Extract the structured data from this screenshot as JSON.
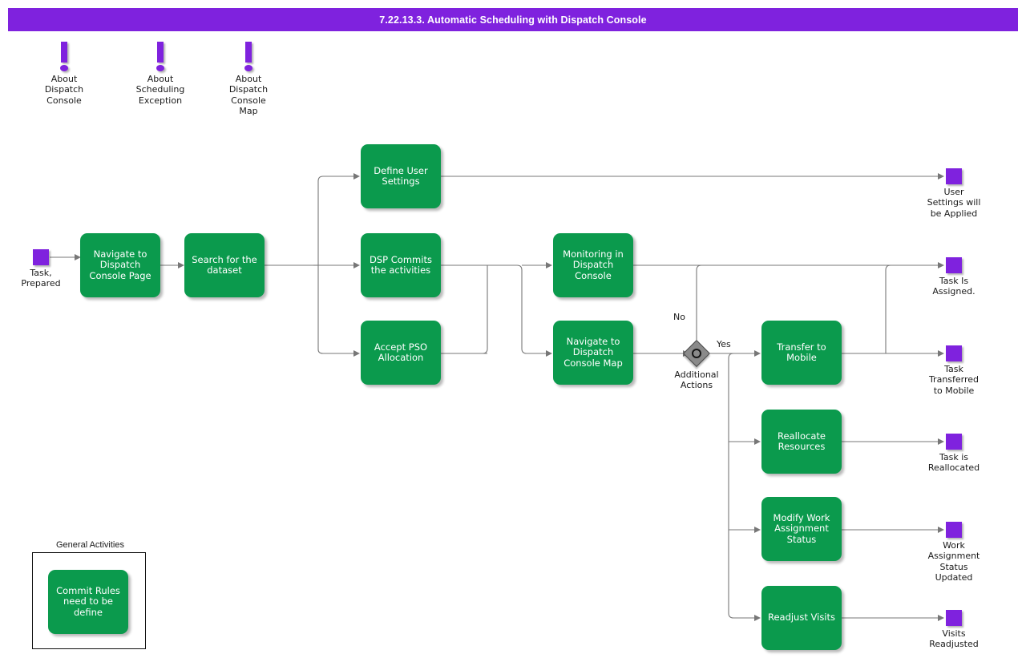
{
  "header": {
    "title": "7.22.13.3. Automatic Scheduling with Dispatch Console",
    "bar_color": "#7F22DE"
  },
  "palette": {
    "activity_green": "#0B9A4D",
    "node_purple": "#7F22DE",
    "decision_gray": "#8A8A8A",
    "connector_gray": "#777777",
    "text_dark": "#1a1a1a"
  },
  "notes": [
    {
      "label": "About\nDispatch\nConsole",
      "icon": "exclamation-note-icon"
    },
    {
      "label": "About\nScheduling\nException",
      "icon": "exclamation-note-icon"
    },
    {
      "label": "About\nDispatch\nConsole\nMap",
      "icon": "exclamation-note-icon"
    }
  ],
  "start_nodes": [
    {
      "label": "Task,\nPrepared"
    }
  ],
  "activities": [
    {
      "id": "navigate-dc-page",
      "label": "Navigate to\nDispatch\nConsole Page"
    },
    {
      "id": "search-dataset",
      "label": "Search for the\ndataset"
    },
    {
      "id": "define-user-settings",
      "label": "Define User\nSettings"
    },
    {
      "id": "dsp-commits",
      "label": "DSP Commits\nthe activities"
    },
    {
      "id": "accept-pso",
      "label": "Accept PSO\nAllocation"
    },
    {
      "id": "monitoring-dc",
      "label": "Monitoring in\nDispatch\nConsole"
    },
    {
      "id": "navigate-dc-map",
      "label": "Navigate to\nDispatch\nConsole Map"
    },
    {
      "id": "transfer-mobile",
      "label": "Transfer to\nMobile"
    },
    {
      "id": "reallocate-resources",
      "label": "Reallocate\nResources"
    },
    {
      "id": "modify-work-status",
      "label": "Modify Work\nAssignment\nStatus"
    },
    {
      "id": "readjust-visits",
      "label": "Readjust Visits"
    },
    {
      "id": "commit-rules",
      "label": "Commit Rules\nneed to be\ndefine"
    }
  ],
  "decision": {
    "label": "Additional\nActions",
    "branch_no": "No",
    "branch_yes": "Yes"
  },
  "end_nodes": [
    {
      "id": "end-user-settings",
      "label": "User\nSettings will\nbe Applied"
    },
    {
      "id": "end-task-assigned",
      "label": "Task Is\nAssigned."
    },
    {
      "id": "end-task-transferred",
      "label": "Task\nTransferred\nto Mobile"
    },
    {
      "id": "end-task-reallocated",
      "label": "Task is\nReallocated"
    },
    {
      "id": "end-work-status",
      "label": "Work\nAssignment\nStatus\nUpdated"
    },
    {
      "id": "end-visits-readjusted",
      "label": "Visits\nReadjusted"
    }
  ],
  "groups": [
    {
      "id": "general-activities",
      "title": "General Activities"
    }
  ]
}
